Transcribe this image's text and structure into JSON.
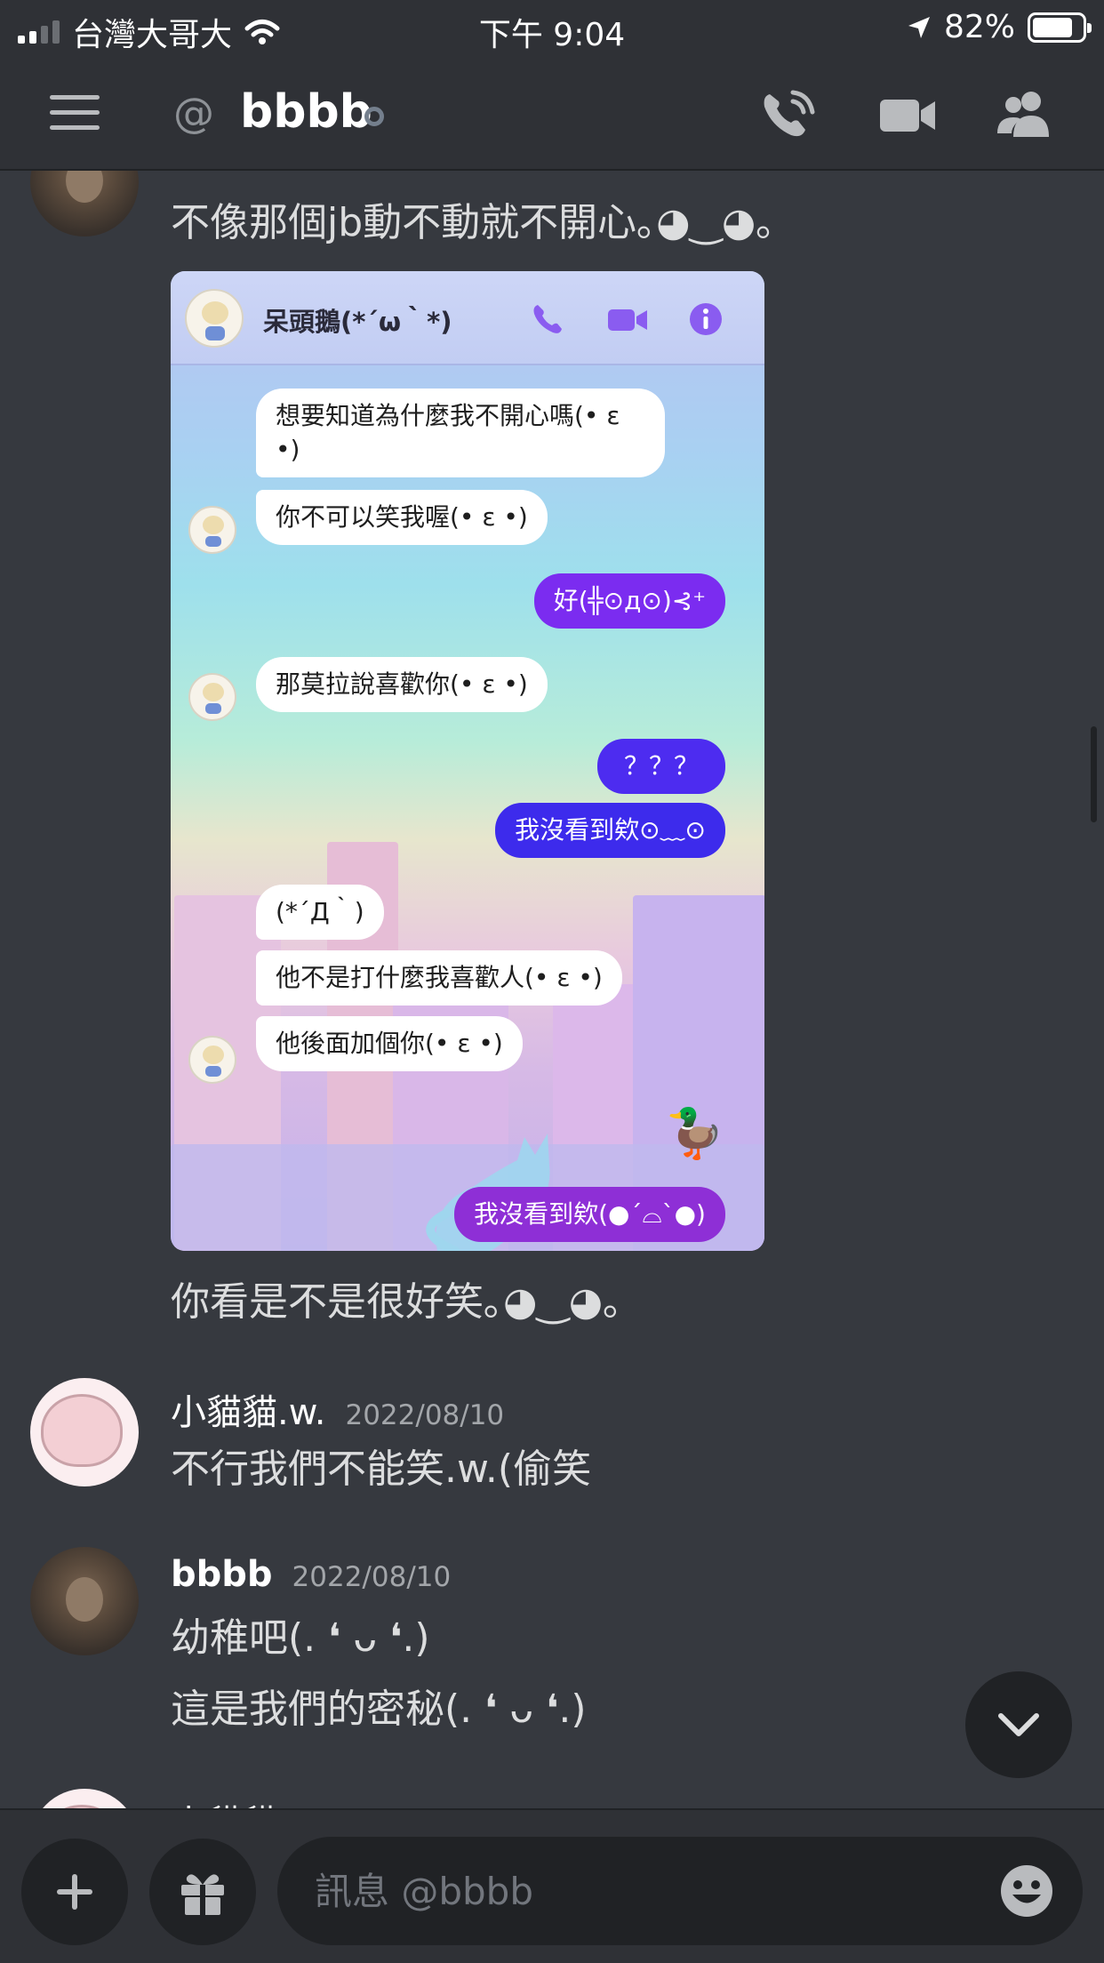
{
  "status_bar": {
    "carrier": "台灣大哥大",
    "time": "下午 9:04",
    "battery_text": "82%",
    "battery_level": 0.82
  },
  "header": {
    "channel_title": "bbbb"
  },
  "messages": {
    "first_group": {
      "line1": "不像那個jb動不動就不開心｡◕‿◕｡",
      "caption": "你看是不是很好笑｡◕‿◕｡"
    },
    "embedded_screenshot": {
      "contact_name": "呆頭鵝(*´ω｀*)",
      "bubbles": [
        {
          "side": "in",
          "text": "想要知道為什麼我不開心嗎(• ε •)"
        },
        {
          "side": "in",
          "text": "你不可以笑我喔(• ε •)"
        },
        {
          "side": "out",
          "text": "好(╬⊙д⊙)⊰⁺"
        },
        {
          "side": "in",
          "text": "那莫拉說喜歡你(• ε •)"
        },
        {
          "side": "out",
          "text": "？？？"
        },
        {
          "side": "out",
          "text": "我沒看到欸⊙﹏⊙"
        },
        {
          "side": "in",
          "text": "(*´Д｀)"
        },
        {
          "side": "in",
          "text": "他不是打什麼我喜歡人(• ε •)"
        },
        {
          "side": "in",
          "text": "他後面加個你(• ε •)"
        },
        {
          "side": "out",
          "text": "我沒看到欸(●´⌓`●)"
        }
      ]
    },
    "kitten_group": {
      "author": "小貓貓.w.",
      "timestamp": "2022/08/10",
      "text": "不行我們不能笑.w.(偷笑"
    },
    "bbbb_group": {
      "author": "bbbb",
      "timestamp": "2022/08/10",
      "lines": [
        "幼稚吧(. ❛ ᴗ ❛.)",
        "這是我們的密秘(. ❛ ᴗ ❛.)"
      ]
    },
    "next_author_partial": "小貓貓"
  },
  "composer": {
    "placeholder": "訊息 @bbbb"
  },
  "icons": {
    "menu": "hamburger-menu-icon",
    "at": "at-sign-icon",
    "call": "phone-call-icon",
    "video": "video-camera-icon",
    "members": "members-icon",
    "add": "plus-icon",
    "gift": "gift-icon",
    "emoji": "emoji-icon",
    "jump": "chevron-down-icon"
  },
  "colors": {
    "background": "#36393f",
    "header": "#2f3136",
    "dark": "#202225",
    "text": "#dcddde",
    "muted": "#72767d",
    "messenger_purple": "#7b2cf0"
  }
}
